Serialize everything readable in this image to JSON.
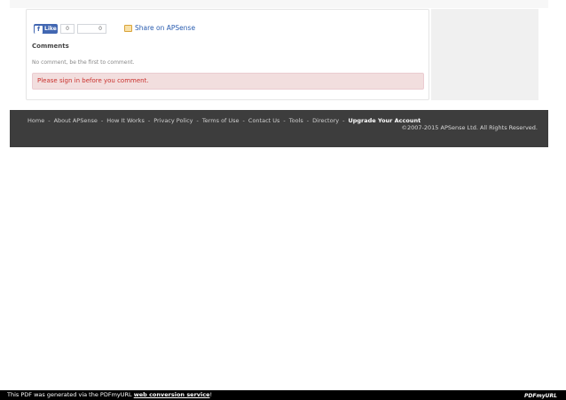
{
  "social": {
    "like_label": "Like",
    "like_count": "0",
    "share_count": "0",
    "share_label": "Share on APSense"
  },
  "comments": {
    "title": "Comments",
    "empty_text": "No comment, be the first to comment.",
    "signin_notice": "Please sign in before you comment."
  },
  "footer": {
    "links": [
      {
        "label": "Home"
      },
      {
        "label": "About APSense"
      },
      {
        "label": "How It Works"
      },
      {
        "label": "Privacy Policy"
      },
      {
        "label": "Terms of Use"
      },
      {
        "label": "Contact Us"
      },
      {
        "label": "Tools"
      },
      {
        "label": "Directory"
      },
      {
        "label": "Upgrade Your Account"
      }
    ],
    "separator": "-",
    "copyright": "©2007-2015 APSense Ltd. All Rights Reserved."
  },
  "pdf_bar": {
    "prefix": "This PDF was generated via the PDFmyURL",
    "link": "web conversion service",
    "suffix": "!",
    "logo": "PDFmyURL"
  }
}
